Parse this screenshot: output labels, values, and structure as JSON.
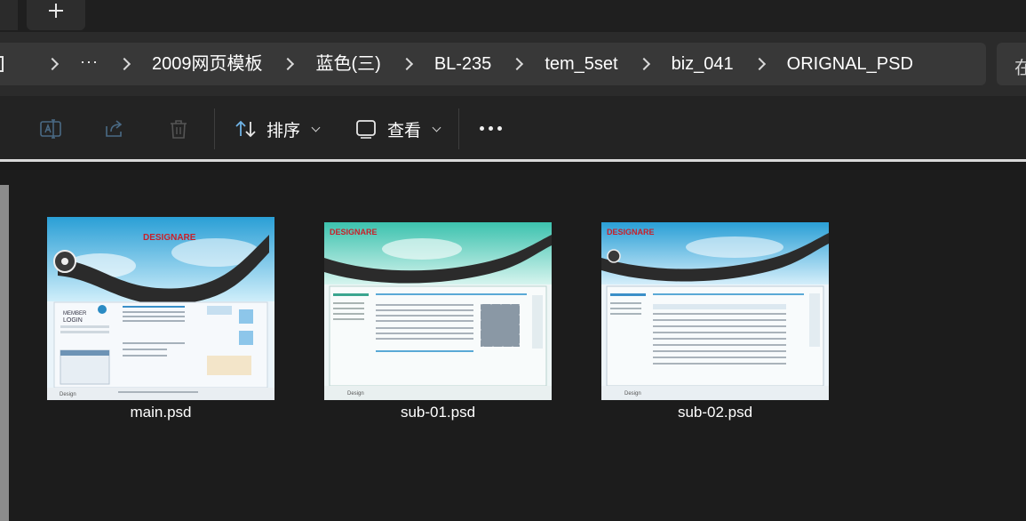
{
  "tabstrip": {
    "close_glyph": "×",
    "new_tab_icon": "plus-icon"
  },
  "breadcrumb": {
    "more_label": "···",
    "items": [
      "2009网页模板",
      "蓝色(三)",
      "BL-235",
      "tem_5set",
      "biz_041",
      "ORIGNAL_PSD"
    ]
  },
  "search": {
    "placeholder_visible": "在"
  },
  "commandbar": {
    "rename_icon": "rename-icon",
    "share_icon": "share-icon",
    "delete_icon": "trash-icon",
    "sort_label": "排序",
    "view_label": "查看",
    "more_icon": "more-dots-icon"
  },
  "files": [
    {
      "name": "main.psd",
      "theme": "#3aa7d8"
    },
    {
      "name": "sub-01.psd",
      "theme": "#2fb7a6"
    },
    {
      "name": "sub-02.psd",
      "theme": "#3aa7d8"
    }
  ],
  "thumb": {
    "logo_text": "DESIGNARE",
    "footer_text": "Design"
  },
  "colors": {
    "accent_blue": "#6fb3e6",
    "background": "#1c1c1c",
    "address_bg": "#383838",
    "command_bg": "#232323"
  }
}
